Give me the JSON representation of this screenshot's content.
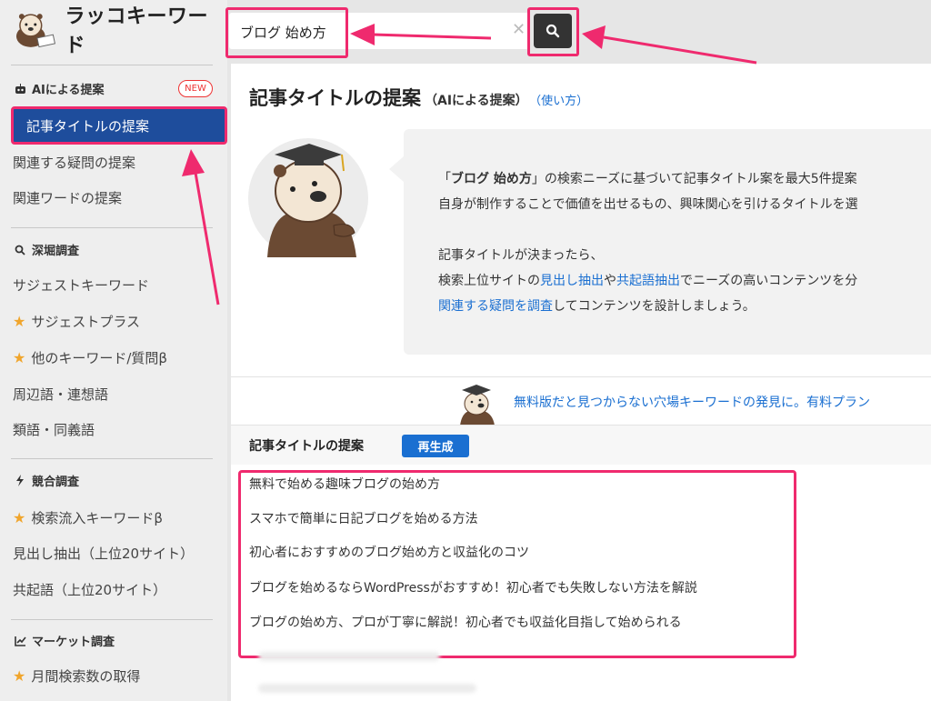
{
  "app": {
    "logo_text": "ラッコキーワード"
  },
  "search": {
    "value": "ブログ 始め方",
    "clear_icon": "close-icon",
    "button_icon": "search-icon"
  },
  "sidebar": {
    "sections": [
      {
        "title": "AIによる提案",
        "icon": "robot-icon",
        "badge": "NEW"
      },
      {
        "title": "深堀調査",
        "icon": "magnifier-icon"
      },
      {
        "title": "競合調査",
        "icon": "bolt-icon"
      },
      {
        "title": "マーケット調査",
        "icon": "chart-icon"
      }
    ],
    "items": [
      {
        "label": "記事タイトルの提案",
        "active": true
      },
      {
        "label": "関連する疑問の提案"
      },
      {
        "label": "関連ワードの提案"
      },
      {
        "label": "サジェストキーワード"
      },
      {
        "label": "サジェストプラス",
        "star": true
      },
      {
        "label": "他のキーワード/質問β",
        "star": true
      },
      {
        "label": "周辺語・連想語"
      },
      {
        "label": "類語・同義語"
      },
      {
        "label": "検索流入キーワードβ",
        "star": true
      },
      {
        "label": "見出し抽出（上位20サイト）"
      },
      {
        "label": "共起語（上位20サイト）"
      },
      {
        "label": "月間検索数の取得",
        "star": true
      }
    ]
  },
  "main": {
    "title": "記事タイトルの提案",
    "subtitle": "（AIによる提案）",
    "howto": "（使い方）",
    "bubble": {
      "quote_open": "「",
      "keyword": "ブログ 始め方",
      "line1_rest": "」の検索ニーズに基づいて記事タイトル案を最大5件提案",
      "line2": "自身が制作することで価値を出せるもの、興味関心を引けるタイトルを選",
      "line3": "記事タイトルが決まったら、",
      "line4_a": "検索上位サイトの",
      "line4_link1": "見出し抽出",
      "line4_b": "や",
      "line4_link2": "共起語抽出",
      "line4_c": "でニーズの高いコンテンツを分",
      "line5_link": "関連する疑問を調査",
      "line5_rest": "してコンテンツを設計しましょう。"
    },
    "promo": "無料版だと見つからない穴場キーワードの発見に。有料プラン",
    "results_title": "記事タイトルの提案",
    "regenerate": "再生成",
    "results": [
      "無料で始める趣味ブログの始め方",
      "スマホで簡単に日記ブログを始める方法",
      "初心者におすすめのブログ始め方と収益化のコツ",
      "ブログを始めるならWordPressがおすすめ！初心者でも失敗しない方法を解説",
      "ブログの始め方、プロが丁寧に解説！初心者でも収益化目指して始められる"
    ]
  },
  "colors": {
    "accent": "#1e4d9c",
    "highlight": "#ef2a6e",
    "link": "#1a6fd1",
    "star": "#f0a52c"
  }
}
